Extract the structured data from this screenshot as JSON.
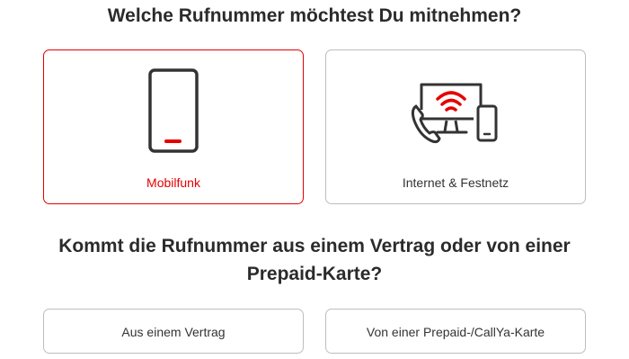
{
  "question_1": {
    "title": "Welche Rufnummer möchtest Du mitnehmen?",
    "options": [
      {
        "label": "Mobilfunk",
        "icon": "mobile-phone-icon",
        "selected": true
      },
      {
        "label": "Internet & Festnetz",
        "icon": "internet-landline-icon",
        "selected": false
      }
    ]
  },
  "question_2": {
    "title_line_1": "Kommt die Rufnummer aus einem Vertrag oder von einer",
    "title_line_2": "Prepaid-Karte?",
    "options": [
      {
        "label": "Aus einem Vertrag"
      },
      {
        "label": "Von einer Prepaid-/CallYa-Karte"
      }
    ]
  },
  "colors": {
    "accent": "#e60000",
    "border": "#bdbdbd",
    "text": "#333333",
    "icon_stroke": "#333333"
  }
}
